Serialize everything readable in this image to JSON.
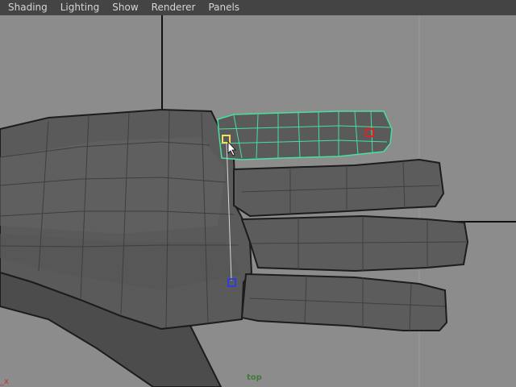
{
  "menu": {
    "items": [
      "Shading",
      "Lighting",
      "Show",
      "Renderer",
      "Panels"
    ]
  },
  "viewport": {
    "camera_label": "top",
    "axis_label": "_x"
  },
  "colors": {
    "menubar_bg": "#444444",
    "viewport_bg": "#8c8c8c",
    "selection_wire": "#46e0a0",
    "handle_yellow": "#f2e05a",
    "handle_red": "#e02020",
    "handle_blue": "#2a3fe0",
    "camera_label": "#3f7a3a",
    "axis_x": "#c03030"
  },
  "icons": [
    "cursor-arrow-icon"
  ]
}
